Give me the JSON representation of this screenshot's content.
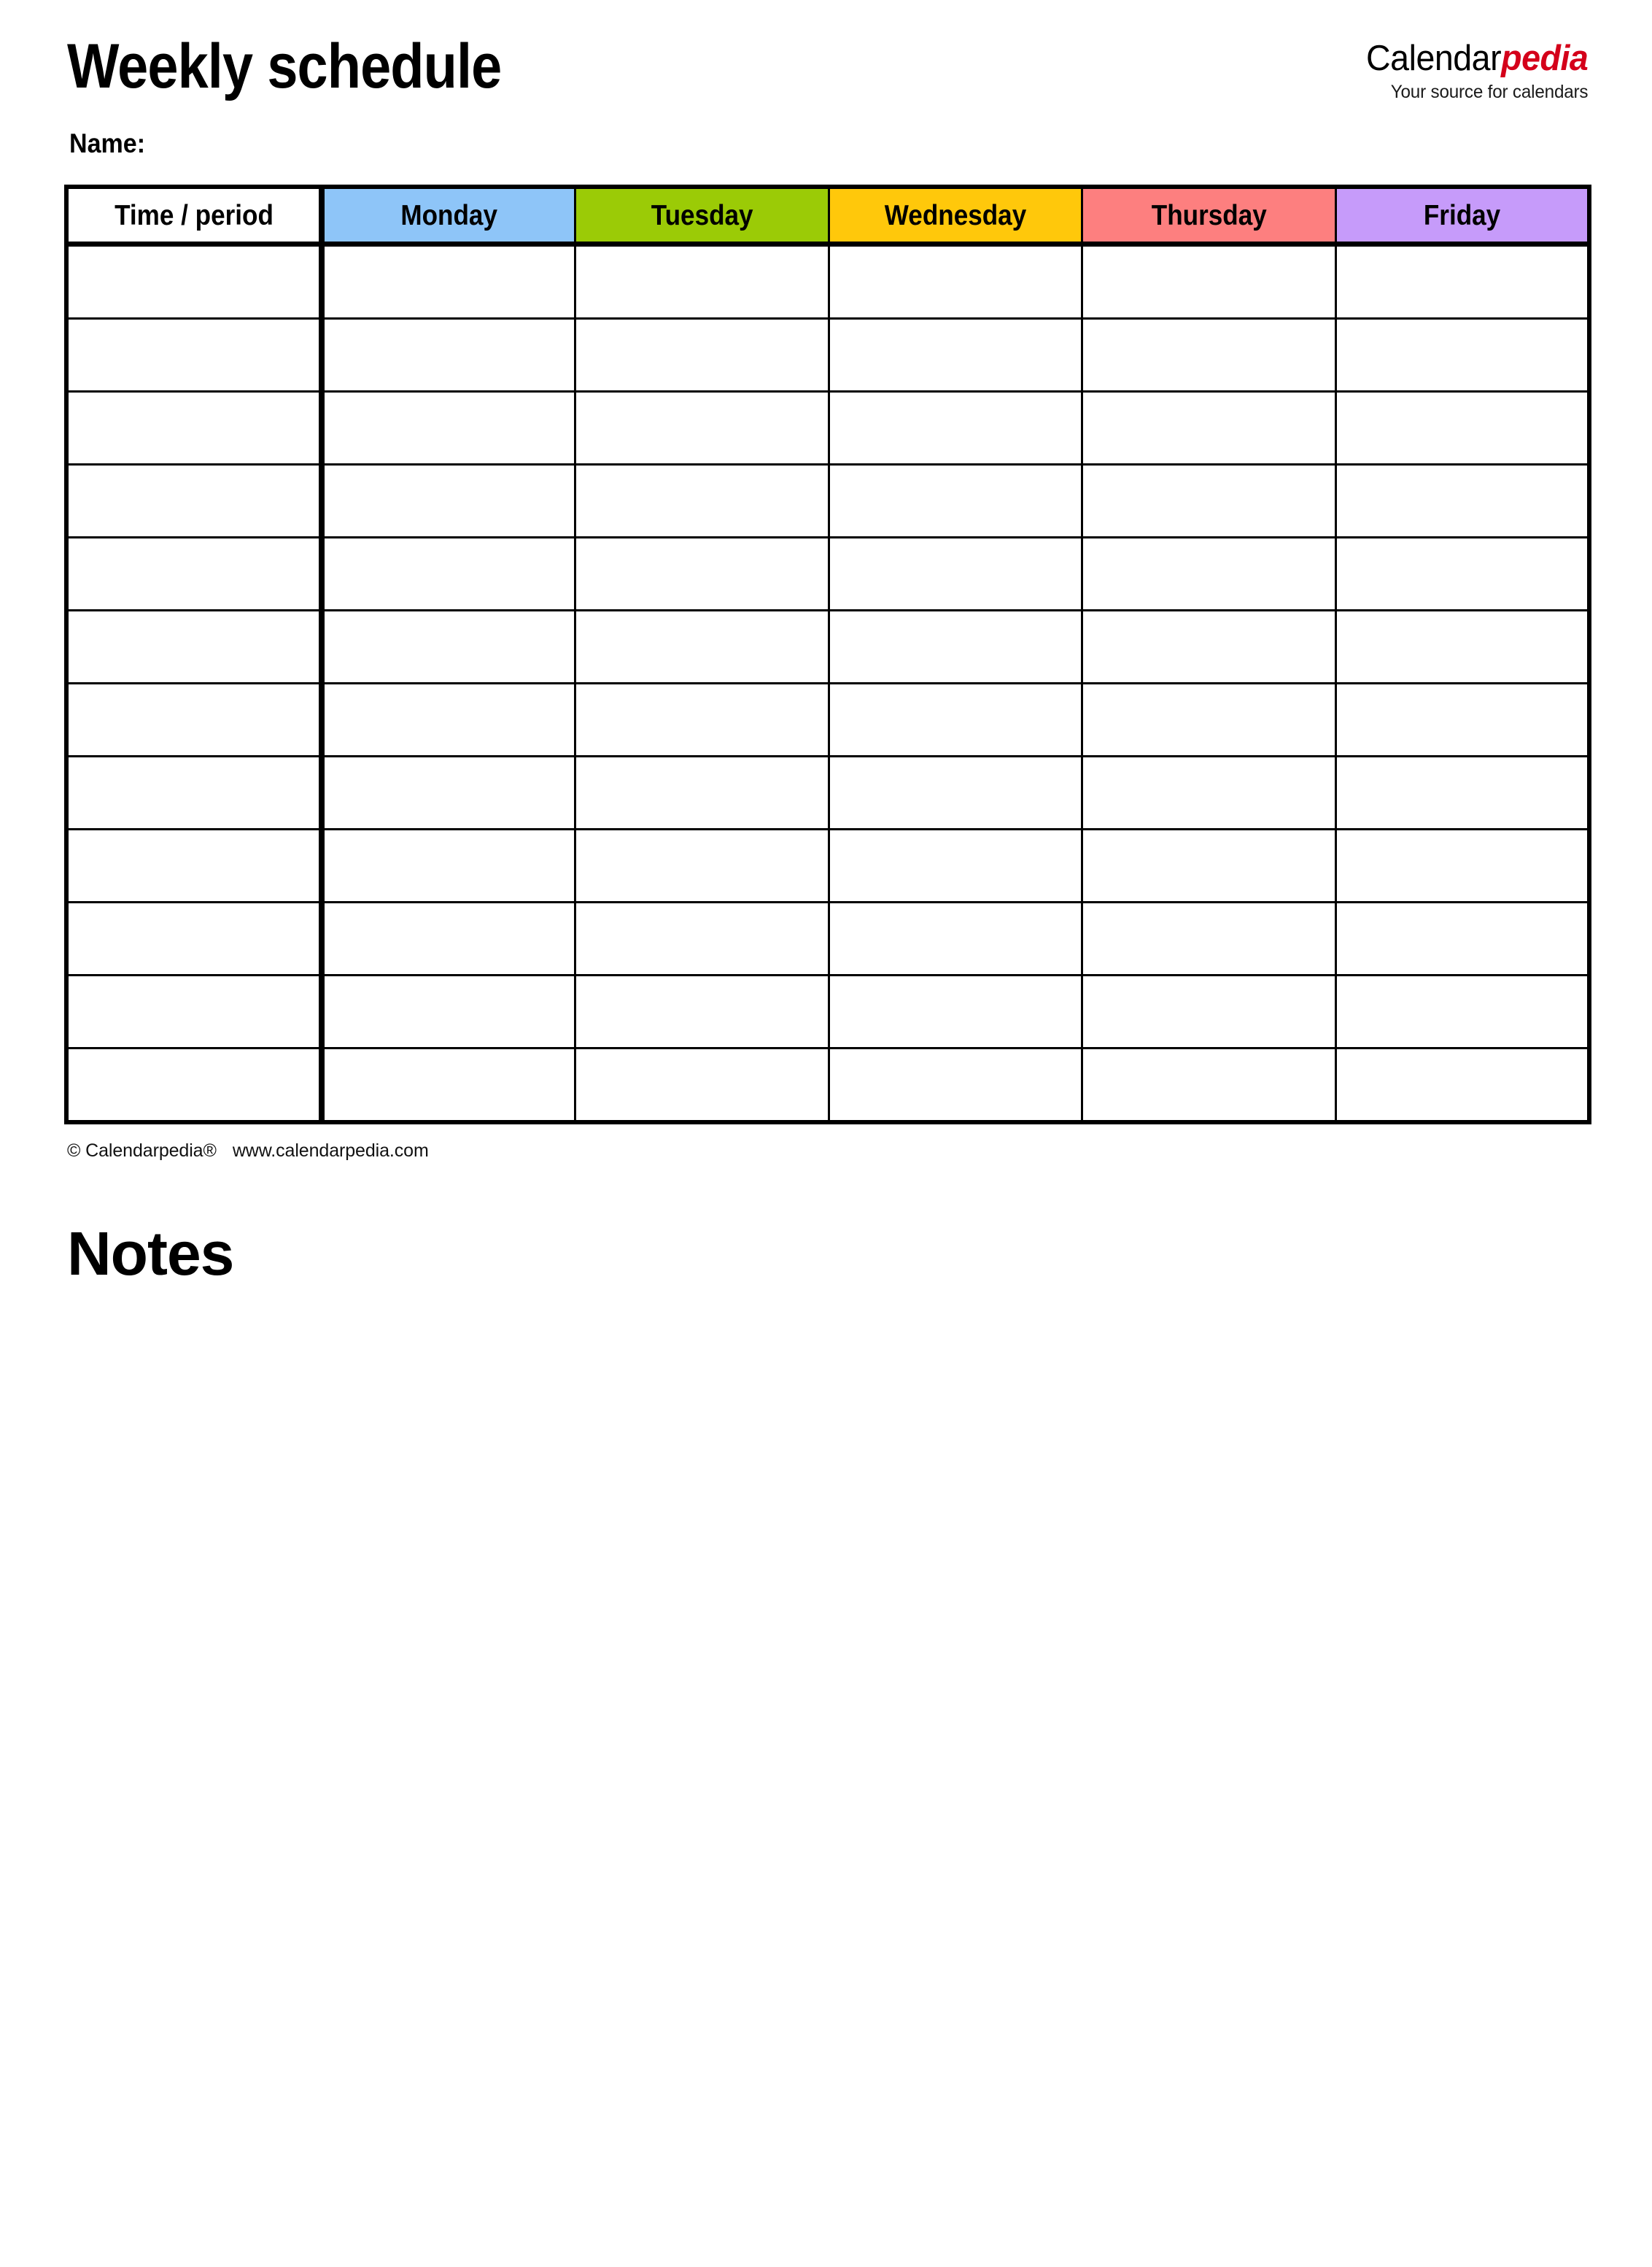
{
  "document": {
    "title": "Weekly schedule",
    "name_label": "Name:"
  },
  "brand": {
    "part1": "Calendar",
    "part2": "pedia",
    "tagline": "Your source for calendars",
    "accent_color": "#D4001A"
  },
  "schedule": {
    "columns": [
      {
        "label": "Time / period",
        "color": "#FFFFFF"
      },
      {
        "label": "Monday",
        "color": "#8EC5F8"
      },
      {
        "label": "Tuesday",
        "color": "#9BCB06"
      },
      {
        "label": "Wednesday",
        "color": "#FFC80B"
      },
      {
        "label": "Thursday",
        "color": "#FD7F7F"
      },
      {
        "label": "Friday",
        "color": "#C69BFA"
      }
    ],
    "row_count": 12,
    "rows": [
      {
        "time": "",
        "monday": "",
        "tuesday": "",
        "wednesday": "",
        "thursday": "",
        "friday": ""
      },
      {
        "time": "",
        "monday": "",
        "tuesday": "",
        "wednesday": "",
        "thursday": "",
        "friday": ""
      },
      {
        "time": "",
        "monday": "",
        "tuesday": "",
        "wednesday": "",
        "thursday": "",
        "friday": ""
      },
      {
        "time": "",
        "monday": "",
        "tuesday": "",
        "wednesday": "",
        "thursday": "",
        "friday": ""
      },
      {
        "time": "",
        "monday": "",
        "tuesday": "",
        "wednesday": "",
        "thursday": "",
        "friday": ""
      },
      {
        "time": "",
        "monday": "",
        "tuesday": "",
        "wednesday": "",
        "thursday": "",
        "friday": ""
      },
      {
        "time": "",
        "monday": "",
        "tuesday": "",
        "wednesday": "",
        "thursday": "",
        "friday": ""
      },
      {
        "time": "",
        "monday": "",
        "tuesday": "",
        "wednesday": "",
        "thursday": "",
        "friday": ""
      },
      {
        "time": "",
        "monday": "",
        "tuesday": "",
        "wednesday": "",
        "thursday": "",
        "friday": ""
      },
      {
        "time": "",
        "monday": "",
        "tuesday": "",
        "wednesday": "",
        "thursday": "",
        "friday": ""
      },
      {
        "time": "",
        "monday": "",
        "tuesday": "",
        "wednesday": "",
        "thursday": "",
        "friday": ""
      },
      {
        "time": "",
        "monday": "",
        "tuesday": "",
        "wednesday": "",
        "thursday": "",
        "friday": ""
      }
    ]
  },
  "footer": {
    "copyright": "© Calendarpedia®",
    "website": "www.calendarpedia.com"
  },
  "notes": {
    "heading": "Notes",
    "content": ""
  }
}
